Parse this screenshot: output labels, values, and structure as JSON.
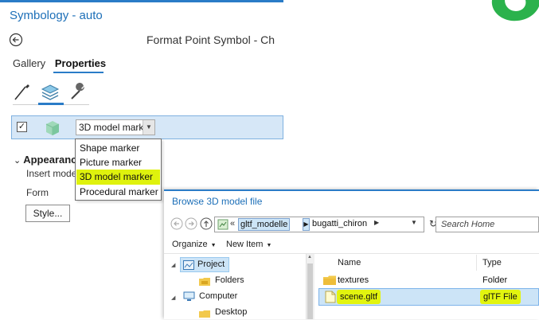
{
  "symbology": {
    "title": "Symbology - auto",
    "format_title": "Format Point Symbol - Ch",
    "tabs": [
      "Gallery",
      "Properties"
    ],
    "active_tab": "Properties",
    "layer_checked": "✓",
    "marker_select_value": "3D model mark",
    "appearance_label": "Appearanc",
    "insert_label": "Insert mode",
    "form_label": "Form",
    "style_button": "Style...",
    "accent_color": "#2a7cc7",
    "title_color": "#1c6fb8"
  },
  "dropdown": {
    "options": [
      "Shape marker",
      "Picture marker",
      "3D model marker",
      "Procedural marker"
    ],
    "selected": "3D model marker",
    "highlight_color": "#dff20d"
  },
  "browse": {
    "title": "Browse 3D model file",
    "path_prefix": "«",
    "path_crumbs": [
      "gltf_modelle",
      "bugatti_chiron"
    ],
    "search_placeholder": "Search Home",
    "organize_label": "Organize",
    "new_item_label": "New Item",
    "tree": [
      "Project",
      "Folders",
      "Computer",
      "Desktop"
    ],
    "columns": {
      "name": "Name",
      "type": "Type"
    },
    "files": [
      {
        "name": "textures",
        "type": "Folder",
        "icon": "folder-icon"
      },
      {
        "name": "scene.gltf",
        "type": "glTF File",
        "icon": "file-icon"
      }
    ]
  }
}
